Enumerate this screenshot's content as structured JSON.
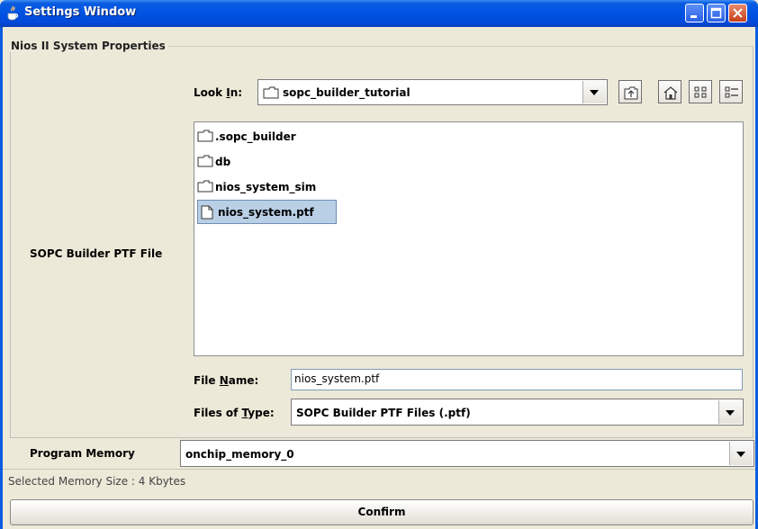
{
  "window": {
    "title": "Settings Window",
    "controls": [
      "minimize-icon",
      "maximize-icon",
      "close-icon"
    ]
  },
  "group": {
    "title": "Nios II System Properties",
    "ptf_label": "SOPC Builder PTF File"
  },
  "chooser": {
    "look_in_label_pre": "Look ",
    "look_in_label_u": "I",
    "look_in_label_post": "n:",
    "look_in_value": "sopc_builder_tutorial",
    "toolbar_icons": [
      "up-folder-icon",
      "home-icon",
      "list-view-icon",
      "details-view-icon"
    ],
    "files": [
      {
        "name": ".sopc_builder",
        "kind": "folder",
        "selected": false
      },
      {
        "name": "db",
        "kind": "folder",
        "selected": false
      },
      {
        "name": "nios_system_sim",
        "kind": "folder",
        "selected": false
      },
      {
        "name": "nios_system.ptf",
        "kind": "file",
        "selected": true
      }
    ],
    "file_name_label_pre": "File ",
    "file_name_label_u": "N",
    "file_name_label_post": "ame:",
    "file_name_value": "nios_system.ptf",
    "files_of_type_label_pre": "Files of ",
    "files_of_type_label_u": "T",
    "files_of_type_label_post": "ype:",
    "files_of_type_value": "SOPC Builder PTF Files (.ptf)"
  },
  "program_memory": {
    "label": "Program Memory",
    "value": "onchip_memory_0"
  },
  "status": {
    "text": "Selected Memory Size : 4 Kbytes"
  },
  "actions": {
    "confirm_label": "Confirm"
  },
  "colors": {
    "titlebar": "#0054e3",
    "selection": "#b8cfe5",
    "background": "#ece9d8"
  }
}
